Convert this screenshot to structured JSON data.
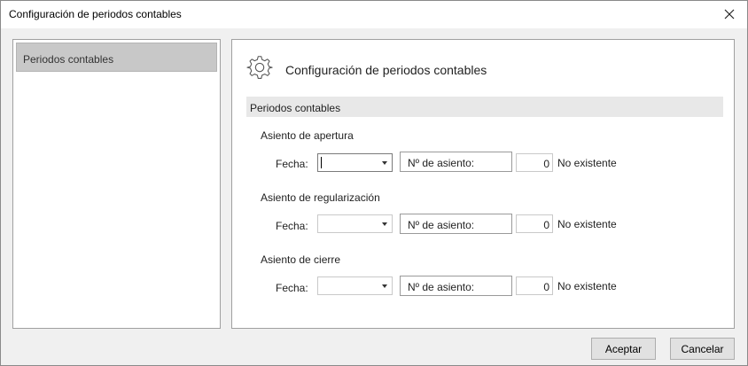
{
  "window": {
    "title": "Configuración de periodos contables"
  },
  "sidebar": {
    "items": [
      {
        "label": "Periodos contables",
        "selected": true
      }
    ]
  },
  "main": {
    "heading": "Configuración de periodos contables",
    "icon": "gear-icon",
    "section_title": "Periodos contables",
    "groups": [
      {
        "title": "Asiento de apertura",
        "fecha_label": "Fecha:",
        "fecha_value": "",
        "asiento_label": "Nº de asiento:",
        "asiento_number": "0",
        "status": "No existente"
      },
      {
        "title": "Asiento de regularización",
        "fecha_label": "Fecha:",
        "fecha_value": "",
        "asiento_label": "Nº de asiento:",
        "asiento_number": "0",
        "status": "No existente"
      },
      {
        "title": "Asiento de cierre",
        "fecha_label": "Fecha:",
        "fecha_value": "",
        "asiento_label": "Nº de asiento:",
        "asiento_number": "0",
        "status": "No existente"
      }
    ]
  },
  "footer": {
    "accept_label": "Aceptar",
    "cancel_label": "Cancelar"
  }
}
